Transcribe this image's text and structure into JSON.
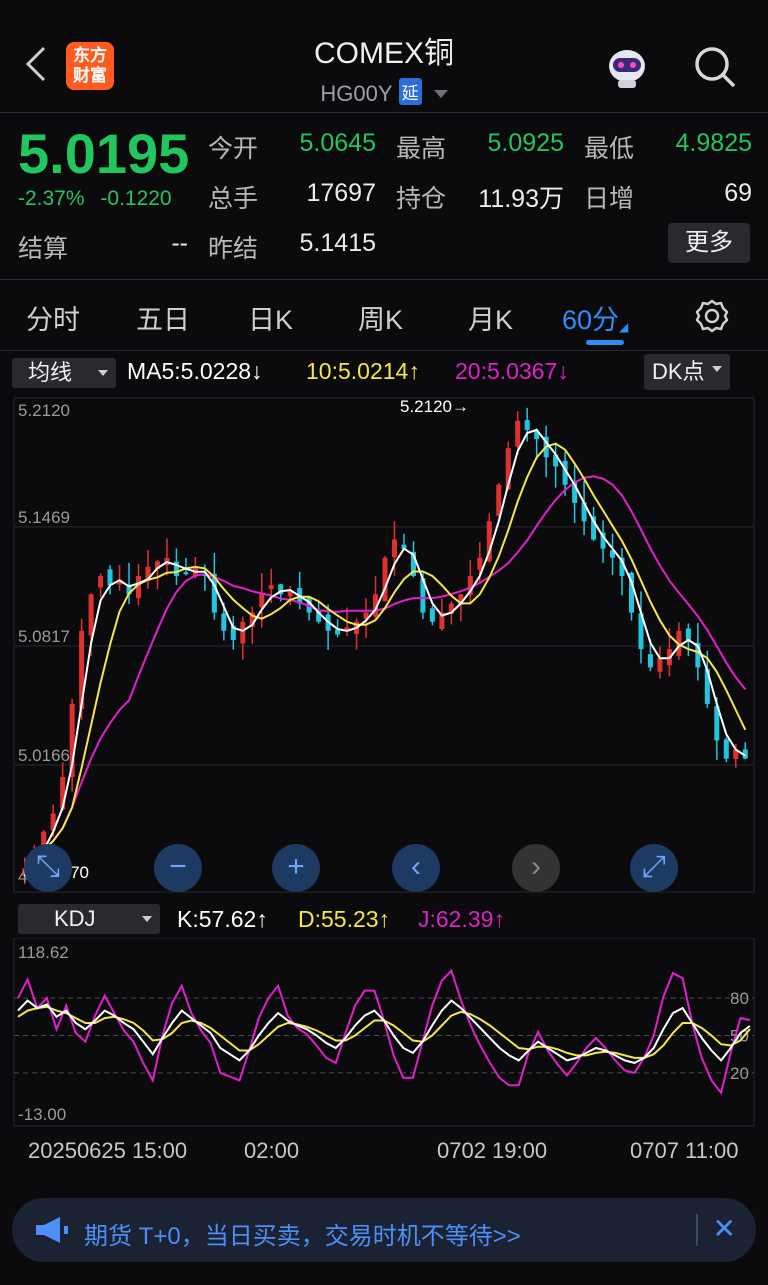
{
  "header": {
    "back_icon": "chevron-left-icon",
    "logo_text": "东方财富",
    "title": "COMEX铜",
    "code": "HG00Y",
    "delay_tag": "延",
    "robot_icon": "robot-assistant-icon",
    "search_icon": "search-icon"
  },
  "quote": {
    "price": "5.0195",
    "change_pct": "-2.37%",
    "change_val": "-0.1220",
    "open_label": "今开",
    "open": "5.0645",
    "high_label": "最高",
    "high": "5.0925",
    "low_label": "最低",
    "low": "4.9825",
    "volume_label": "总手",
    "volume": "17697",
    "oi_label": "持仓",
    "oi": "11.93万",
    "daily_inc_label": "日增",
    "daily_inc": "69",
    "settle_label": "结算",
    "settle": "--",
    "prev_settle_label": "昨结",
    "prev_settle": "5.1415",
    "more_label": "更多"
  },
  "tabs": [
    {
      "label": "分时"
    },
    {
      "label": "五日"
    },
    {
      "label": "日K"
    },
    {
      "label": "周K"
    },
    {
      "label": "月K"
    },
    {
      "label": "60分"
    }
  ],
  "settings_icon": "gear-icon",
  "ma_bar": {
    "selector": "均线",
    "ma5": "MA5:5.0228↓",
    "ma10": "10:5.0214↑",
    "ma20": "20:5.0367↓",
    "dk": "DK点"
  },
  "kdj_bar": {
    "selector": "KDJ",
    "k": "K:57.62↑",
    "d": "D:55.23↑",
    "j": "J:62.39↑"
  },
  "chart_data": [
    {
      "type": "candlestick",
      "y_ticks": [
        "5.2120",
        "5.1469",
        "5.0817",
        "5.0166",
        "4.9514"
      ],
      "ylim": [
        4.9514,
        5.212
      ],
      "max_marker": "5.2120",
      "min_marker": "4.9570",
      "colors": {
        "up": "#e03131",
        "down": "#22c5e0",
        "ma5": "#ffffff",
        "ma10": "#f5e64a",
        "ma20": "#e020c8"
      },
      "closes": [
        4.96,
        4.97,
        4.98,
        4.99,
        5.01,
        5.05,
        5.09,
        5.11,
        5.12,
        5.115,
        5.118,
        5.11,
        5.12,
        5.125,
        5.128,
        5.13,
        5.12,
        5.122,
        5.125,
        5.12,
        5.1,
        5.09,
        5.085,
        5.095,
        5.1,
        5.11,
        5.115,
        5.11,
        5.112,
        5.105,
        5.1,
        5.095,
        5.09,
        5.088,
        5.092,
        5.095,
        5.1,
        5.11,
        5.13,
        5.14,
        5.135,
        5.12,
        5.1,
        5.095,
        5.1,
        5.105,
        5.11,
        5.12,
        5.13,
        5.15,
        5.17,
        5.19,
        5.205,
        5.2,
        5.195,
        5.185,
        5.18,
        5.17,
        5.16,
        5.15,
        5.14,
        5.135,
        5.13,
        5.12,
        5.1,
        5.08,
        5.07,
        5.075,
        5.08,
        5.09,
        5.085,
        5.07,
        5.05,
        5.03,
        5.02,
        5.025,
        5.02
      ]
    },
    {
      "type": "line",
      "y_ticks": [
        "118.62",
        "-13.00"
      ],
      "right_ticks": [
        "80",
        "50",
        "20"
      ],
      "ylim": [
        -13.0,
        118.62
      ],
      "colors": {
        "k": "#ffffff",
        "d": "#f5e64a",
        "j": "#e020c8"
      },
      "k": [
        70,
        78,
        72,
        75,
        65,
        70,
        60,
        55,
        62,
        70,
        66,
        60,
        55,
        45,
        35,
        48,
        60,
        70,
        64,
        58,
        52,
        40,
        35,
        30,
        38,
        50,
        60,
        68,
        62,
        58,
        55,
        50,
        44,
        40,
        48,
        58,
        66,
        70,
        62,
        50,
        40,
        36,
        45,
        58,
        70,
        78,
        72,
        64,
        56,
        48,
        40,
        34,
        30,
        38,
        45,
        40,
        35,
        30,
        32,
        36,
        40,
        38,
        34,
        30,
        28,
        32,
        40,
        55,
        68,
        72,
        60,
        48,
        38,
        30,
        40,
        52,
        57.62
      ],
      "d": [
        65,
        70,
        72,
        73,
        70,
        68,
        64,
        60,
        60,
        64,
        65,
        63,
        60,
        54,
        46,
        47,
        52,
        60,
        62,
        60,
        56,
        50,
        44,
        38,
        38,
        43,
        50,
        57,
        60,
        59,
        57,
        54,
        50,
        46,
        46,
        50,
        56,
        62,
        62,
        58,
        52,
        46,
        45,
        50,
        58,
        66,
        69,
        67,
        63,
        58,
        52,
        46,
        40,
        39,
        41,
        41,
        39,
        36,
        34,
        34,
        36,
        37,
        36,
        34,
        32,
        32,
        35,
        42,
        52,
        60,
        60,
        56,
        50,
        43,
        42,
        46,
        55.23
      ],
      "j": [
        80,
        95,
        72,
        80,
        55,
        74,
        52,
        45,
        66,
        82,
        68,
        54,
        45,
        28,
        14,
        50,
        76,
        90,
        68,
        54,
        44,
        20,
        17,
        14,
        38,
        64,
        80,
        90,
        66,
        56,
        51,
        42,
        32,
        28,
        52,
        74,
        86,
        86,
        62,
        34,
        16,
        16,
        45,
        74,
        94,
        102,
        78,
        58,
        42,
        28,
        16,
        10,
        10,
        36,
        53,
        38,
        27,
        18,
        28,
        40,
        48,
        40,
        30,
        22,
        20,
        32,
        50,
        81,
        100,
        96,
        60,
        32,
        14,
        4,
        36,
        64,
        62.39
      ]
    }
  ],
  "time_axis": [
    "20250625 15:00",
    "02:00",
    "0702 19:00",
    "0707 11:00"
  ],
  "chart_controls": [
    "zoom-out-icon",
    "zoom-in-icon",
    "chevron-left-icon",
    "chevron-right-icon",
    "fullscreen-icon"
  ],
  "banner": {
    "icon": "megaphone-icon",
    "text": "期货 T+0，当日买卖，交易时机不等待>>",
    "close_icon": "close-icon"
  }
}
